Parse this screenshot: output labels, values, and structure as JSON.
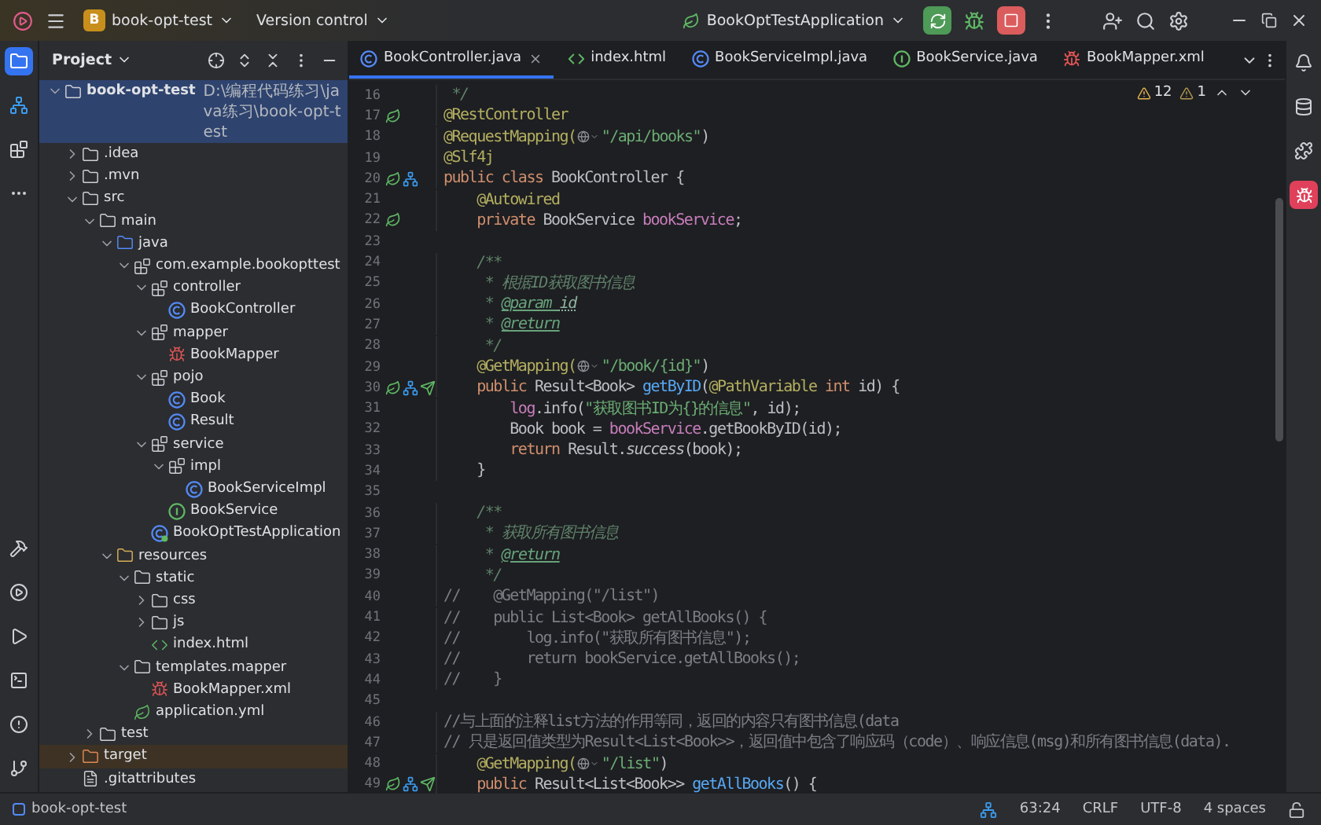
{
  "title_bar": {
    "project_badge": "B",
    "project": "book-opt-test",
    "vcs": "Version control",
    "run_config": "BookOptTestApplication"
  },
  "project_panel": {
    "title": "Project",
    "tree": [
      {
        "label": "book-opt-test",
        "path": "D:\\编程代码练习\\java练习\\book-opt-test",
        "kind": "module",
        "selected": true,
        "expanded": true,
        "children": [
          {
            "label": ".idea",
            "kind": "folder",
            "selected": false,
            "expanded": false
          },
          {
            "label": ".mvn",
            "kind": "folder",
            "selected": false,
            "expanded": false
          },
          {
            "label": "src",
            "kind": "folder",
            "selected": false,
            "expanded": true,
            "children": [
              {
                "label": "main",
                "kind": "folder",
                "selected": false,
                "expanded": true,
                "children": [
                  {
                    "label": "java",
                    "kind": "source",
                    "selected": false,
                    "expanded": true,
                    "children": [
                      {
                        "label": "com.example.bookopttest",
                        "kind": "package",
                        "selected": false,
                        "expanded": true,
                        "children": [
                          {
                            "label": "controller",
                            "kind": "package",
                            "selected": false,
                            "expanded": true,
                            "children": [
                              {
                                "label": "BookController",
                                "kind": "class",
                                "selected": false
                              }
                            ]
                          },
                          {
                            "label": "mapper",
                            "kind": "package",
                            "selected": false,
                            "expanded": true,
                            "children": [
                              {
                                "label": "BookMapper",
                                "kind": "mapper",
                                "selected": false
                              }
                            ]
                          },
                          {
                            "label": "pojo",
                            "kind": "package",
                            "selected": false,
                            "expanded": true,
                            "children": [
                              {
                                "label": "Book",
                                "kind": "class",
                                "selected": false
                              },
                              {
                                "label": "Result",
                                "kind": "class",
                                "selected": false
                              }
                            ]
                          },
                          {
                            "label": "service",
                            "kind": "package",
                            "selected": false,
                            "expanded": true,
                            "children": [
                              {
                                "label": "impl",
                                "kind": "package",
                                "selected": false,
                                "expanded": true,
                                "children": [
                                  {
                                    "label": "BookServiceImpl",
                                    "kind": "class",
                                    "selected": false
                                  }
                                ]
                              },
                              {
                                "label": "BookService",
                                "kind": "interface",
                                "selected": false
                              }
                            ]
                          },
                          {
                            "label": "BookOptTestApplication",
                            "kind": "app",
                            "selected": false
                          }
                        ]
                      }
                    ]
                  },
                  {
                    "label": "resources",
                    "kind": "resources",
                    "selected": false,
                    "expanded": true,
                    "children": [
                      {
                        "label": "static",
                        "kind": "folder",
                        "selected": false,
                        "expanded": true,
                        "children": [
                          {
                            "label": "css",
                            "kind": "folder",
                            "selected": false,
                            "expanded": false
                          },
                          {
                            "label": "js",
                            "kind": "folder",
                            "selected": false,
                            "expanded": false
                          },
                          {
                            "label": "index.html",
                            "kind": "html",
                            "selected": false
                          }
                        ]
                      },
                      {
                        "label": "templates.mapper",
                        "kind": "folder",
                        "selected": false,
                        "expanded": true,
                        "children": [
                          {
                            "label": "BookMapper.xml",
                            "kind": "xml",
                            "selected": false
                          }
                        ]
                      },
                      {
                        "label": "application.yml",
                        "kind": "yml",
                        "selected": false
                      }
                    ]
                  }
                ]
              },
              {
                "label": "test",
                "kind": "folder",
                "selected": false,
                "expanded": false
              }
            ]
          },
          {
            "label": "target",
            "kind": "excluded",
            "selected": false,
            "expanded": false
          },
          {
            "label": ".gitattributes",
            "kind": "text",
            "selected": false
          }
        ]
      }
    ]
  },
  "tabs": [
    {
      "label": "BookController.java",
      "kind": "class",
      "selected": true
    },
    {
      "label": "index.html",
      "kind": "html",
      "selected": false
    },
    {
      "label": "BookServiceImpl.java",
      "kind": "class",
      "selected": false
    },
    {
      "label": "BookService.java",
      "kind": "interface",
      "selected": false
    },
    {
      "label": "BookMapper.xml",
      "kind": "xml",
      "selected": false
    }
  ],
  "inspections": {
    "warnings": "12",
    "weak_warnings": "1"
  },
  "code": [
    {
      "n": "16",
      "segs": [
        {
          "kind": "doc",
          "t": " */"
        }
      ]
    },
    {
      "n": "17",
      "markers": [
        {
          "kind": "bean"
        }
      ],
      "segs": [
        {
          "kind": "ann",
          "t": "@RestController"
        }
      ]
    },
    {
      "n": "18",
      "segs": [
        {
          "kind": "ann",
          "t": "@RequestMapping("
        },
        {
          "kind": "url"
        },
        {
          "kind": "str",
          "t": "\"/api/books\""
        },
        {
          "kind": "plain",
          "t": ")"
        }
      ]
    },
    {
      "n": "19",
      "segs": [
        {
          "kind": "ann",
          "t": "@Slf4j"
        }
      ]
    },
    {
      "n": "20",
      "markers": [
        {
          "kind": "bean"
        },
        {
          "kind": "impl"
        }
      ],
      "segs": [
        {
          "kind": "kw",
          "t": "public class "
        },
        {
          "kind": "plain",
          "t": "BookController {"
        }
      ]
    },
    {
      "n": "21",
      "segs": [
        {
          "kind": "ann",
          "t": "    @Autowired"
        }
      ]
    },
    {
      "n": "22",
      "markers": [
        {
          "kind": "bean"
        }
      ],
      "segs": [
        {
          "kind": "kw",
          "t": "    private "
        },
        {
          "kind": "plain",
          "t": "BookService "
        },
        {
          "kind": "field",
          "t": "bookService"
        },
        {
          "kind": "plain",
          "t": ";"
        }
      ]
    },
    {
      "n": "23"
    },
    {
      "n": "24",
      "segs": [
        {
          "kind": "doc",
          "t": "    /**"
        }
      ]
    },
    {
      "n": "25",
      "segs": [
        {
          "kind": "doc",
          "t": "     * 根据ID获取图书信息"
        }
      ]
    },
    {
      "n": "26",
      "segs": [
        {
          "kind": "doc",
          "t": "     * "
        },
        {
          "kind": "doctag",
          "t": "@param "
        },
        {
          "kind": "docparam",
          "t": "id"
        }
      ]
    },
    {
      "n": "27",
      "segs": [
        {
          "kind": "doc",
          "t": "     * "
        },
        {
          "kind": "doctag",
          "t": "@return"
        }
      ]
    },
    {
      "n": "28",
      "segs": [
        {
          "kind": "doc",
          "t": "     */"
        }
      ]
    },
    {
      "n": "29",
      "segs": [
        {
          "kind": "ann",
          "t": "    @GetMapping("
        },
        {
          "kind": "url"
        },
        {
          "kind": "str",
          "t": "\"/book/{id}\""
        },
        {
          "kind": "plain",
          "t": ")"
        }
      ]
    },
    {
      "n": "30",
      "markers": [
        {
          "kind": "bean"
        },
        {
          "kind": "impl"
        },
        {
          "kind": "endpoint"
        }
      ],
      "segs": [
        {
          "kind": "kw",
          "t": "    public "
        },
        {
          "kind": "plain",
          "t": "Result<Book> "
        },
        {
          "kind": "method",
          "t": "getByID"
        },
        {
          "kind": "plain",
          "t": "("
        },
        {
          "kind": "ann",
          "t": "@PathVariable "
        },
        {
          "kind": "kw",
          "t": "int "
        },
        {
          "kind": "plain",
          "t": "id) {"
        }
      ]
    },
    {
      "n": "31",
      "segs": [
        {
          "kind": "field",
          "t": "        log"
        },
        {
          "kind": "plain",
          "t": ".info("
        },
        {
          "kind": "str",
          "t": "\"获取图书ID为{}的信息\""
        },
        {
          "kind": "plain",
          "t": ", id);"
        }
      ]
    },
    {
      "n": "32",
      "segs": [
        {
          "kind": "plain",
          "t": "        Book book = "
        },
        {
          "kind": "field",
          "t": "bookService"
        },
        {
          "kind": "plain",
          "t": ".getBookByID(id);"
        }
      ]
    },
    {
      "n": "33",
      "segs": [
        {
          "kind": "kw",
          "t": "        return "
        },
        {
          "kind": "plain",
          "t": "Result."
        },
        {
          "kind": "static",
          "t": "success"
        },
        {
          "kind": "plain",
          "t": "(book);"
        }
      ]
    },
    {
      "n": "34",
      "segs": [
        {
          "kind": "plain",
          "t": "    }"
        }
      ]
    },
    {
      "n": "35"
    },
    {
      "n": "36",
      "segs": [
        {
          "kind": "doc",
          "t": "    /**"
        }
      ]
    },
    {
      "n": "37",
      "segs": [
        {
          "kind": "doc",
          "t": "     * 获取所有图书信息"
        }
      ]
    },
    {
      "n": "38",
      "segs": [
        {
          "kind": "doc",
          "t": "     * "
        },
        {
          "kind": "doctag",
          "t": "@return"
        }
      ]
    },
    {
      "n": "39",
      "segs": [
        {
          "kind": "doc",
          "t": "     */"
        }
      ]
    },
    {
      "n": "40",
      "segs": [
        {
          "kind": "comment",
          "t": "//    @GetMapping(\"/list\")"
        }
      ]
    },
    {
      "n": "41",
      "segs": [
        {
          "kind": "comment",
          "t": "//    public List<Book> getAllBooks() {"
        }
      ]
    },
    {
      "n": "42",
      "segs": [
        {
          "kind": "comment",
          "t": "//        log.info(\"获取所有图书信息\");"
        }
      ]
    },
    {
      "n": "43",
      "segs": [
        {
          "kind": "comment",
          "t": "//        return bookService.getAllBooks();"
        }
      ]
    },
    {
      "n": "44",
      "segs": [
        {
          "kind": "comment",
          "t": "//    }"
        }
      ]
    },
    {
      "n": "45"
    },
    {
      "n": "46",
      "segs": [
        {
          "kind": "comment",
          "t": "//与上面的注释list方法的作用等同，返回的内容只有图书信息(data"
        }
      ]
    },
    {
      "n": "47",
      "segs": [
        {
          "kind": "comment",
          "t": "// 只是返回值类型为Result<List<Book>>，返回值中包含了响应码（code）、响应信息(msg)和所有图书信息(data)."
        }
      ]
    },
    {
      "n": "48",
      "segs": [
        {
          "kind": "ann",
          "t": "    @GetMapping("
        },
        {
          "kind": "url"
        },
        {
          "kind": "str",
          "t": "\"/list\""
        },
        {
          "kind": "plain",
          "t": ")"
        }
      ]
    },
    {
      "n": "49",
      "markers": [
        {
          "kind": "bean"
        },
        {
          "kind": "impl"
        },
        {
          "kind": "endpoint"
        }
      ],
      "segs": [
        {
          "kind": "kw",
          "t": "    public "
        },
        {
          "kind": "plain",
          "t": "Result<List<Book>> "
        },
        {
          "kind": "method",
          "t": "getAllBooks"
        },
        {
          "kind": "plain",
          "t": "() {"
        }
      ]
    }
  ],
  "status_bar": {
    "project": "book-opt-test",
    "position": "63:24",
    "line_ending": "CRLF",
    "encoding": "UTF-8",
    "indent": "4 spaces"
  }
}
